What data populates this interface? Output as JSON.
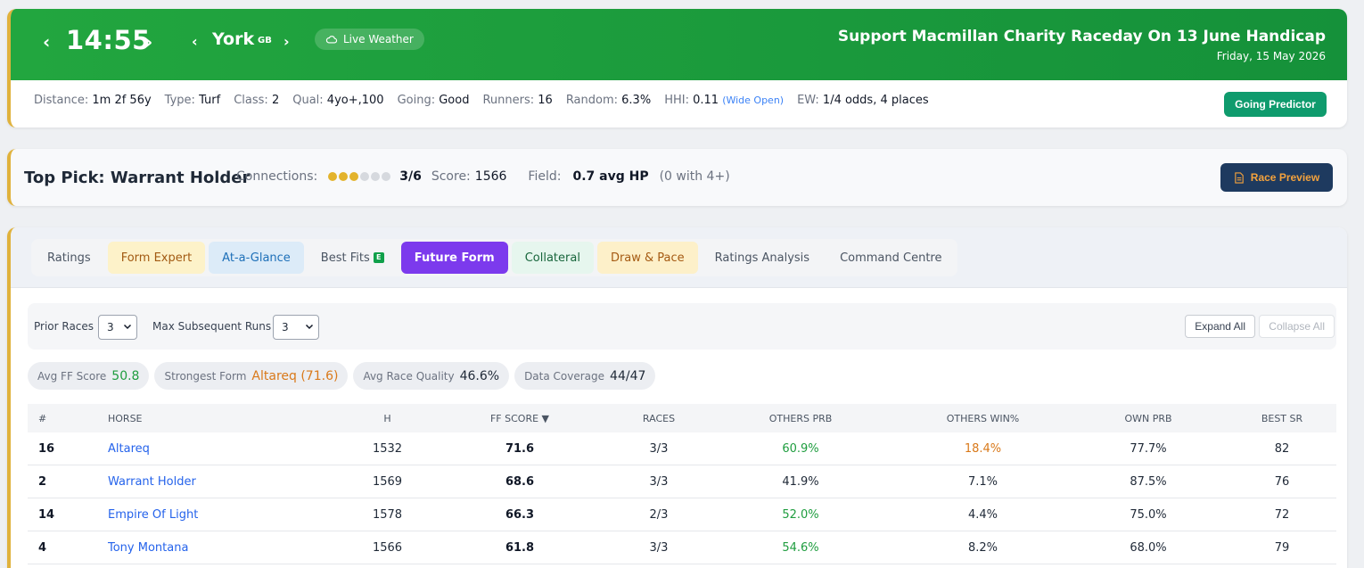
{
  "header": {
    "time": "14:55",
    "course": "York",
    "country": "GB",
    "weather_label": "Live Weather",
    "race_title": "Support Macmillan Charity Raceday On 13 June Handicap",
    "race_date": "Friday, 15 May 2026",
    "colors": {
      "banner": "#22a63f",
      "accent_border": "#e0b23c"
    }
  },
  "stats": {
    "distance_label": "Distance:",
    "distance": "1m 2f 56y",
    "type_label": "Type:",
    "type": "Turf",
    "class_label": "Class:",
    "class": "2",
    "qual_label": "Qual:",
    "qual": "4yo+,100",
    "going_label": "Going:",
    "going": "Good",
    "runners_label": "Runners:",
    "runners": "16",
    "random_label": "Random:",
    "random": "6.3%",
    "hhi_label": "HHI:",
    "hhi": "0.11",
    "hhi_note": "(Wide Open)",
    "ew_label": "EW:",
    "ew": "1/4 odds, 4 places",
    "going_predictor_label": "Going Predictor"
  },
  "top_pick": {
    "title": "Top Pick: Warrant Holder",
    "connections_label": "Connections:",
    "connections_value": "3/6",
    "connections_filled": 3,
    "connections_total": 6,
    "score_label": "Score:",
    "score": "1566",
    "field_label": "Field:",
    "field_value": "0.7 avg HP",
    "field_note": "(0 with 4+)",
    "preview_label": "Race Preview"
  },
  "tabs": {
    "ratings": "Ratings",
    "form_expert": "Form Expert",
    "at_a_glance": "At-a-Glance",
    "best_fits": "Best Fits",
    "best_fits_badge": "E",
    "future_form": "Future Form",
    "collateral": "Collateral",
    "draw_pace": "Draw & Pace",
    "ratings_analysis": "Ratings Analysis",
    "command_centre": "Command Centre",
    "active": "Future Form"
  },
  "controls": {
    "prior_races_label": "Prior Races",
    "prior_races_value": "3",
    "max_runs_label": "Max Subsequent Runs",
    "max_runs_value": "3",
    "expand_all": "Expand All",
    "collapse_all": "Collapse All"
  },
  "summary": {
    "avg_ff_label": "Avg FF Score",
    "avg_ff": "50.8",
    "strongest_label": "Strongest Form",
    "strongest": "Altareq (71.6)",
    "avg_quality_label": "Avg Race Quality",
    "avg_quality": "46.6%",
    "coverage_label": "Data Coverage",
    "coverage": "44/47"
  },
  "table": {
    "headers": {
      "num": "#",
      "horse": "Horse",
      "h": "H",
      "ff": "FF Score ▼",
      "races": "Races",
      "others_prb": "Others PRB",
      "others_win": "Others Win%",
      "own_prb": "Own PRB",
      "best_sr": "Best SR"
    },
    "rows": [
      {
        "num": "16",
        "horse": "Altareq",
        "h": "1532",
        "ff": "71.6",
        "races": "3/3",
        "others_prb": "60.9%",
        "others_win": "18.4%",
        "own_prb": "77.7%",
        "best_sr": "82"
      },
      {
        "num": "2",
        "horse": "Warrant Holder",
        "h": "1569",
        "ff": "68.6",
        "races": "3/3",
        "others_prb": "41.9%",
        "others_win": "7.1%",
        "own_prb": "87.5%",
        "best_sr": "76"
      },
      {
        "num": "14",
        "horse": "Empire Of Light",
        "h": "1578",
        "ff": "66.3",
        "races": "2/3",
        "others_prb": "52.0%",
        "others_win": "4.4%",
        "own_prb": "75.0%",
        "best_sr": "72"
      },
      {
        "num": "4",
        "horse": "Tony Montana",
        "h": "1566",
        "ff": "61.8",
        "races": "3/3",
        "others_prb": "54.6%",
        "others_win": "8.2%",
        "own_prb": "68.0%",
        "best_sr": "79"
      }
    ]
  }
}
